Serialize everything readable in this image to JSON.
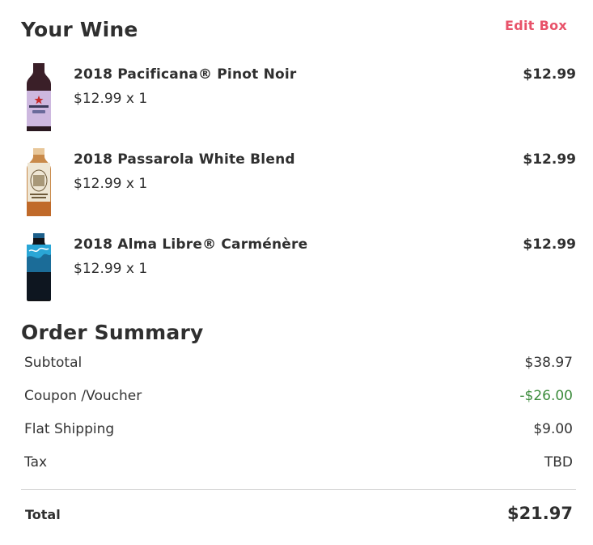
{
  "wine_section": {
    "title": "Your Wine",
    "edit_label": "Edit Box",
    "items": [
      {
        "name": "2018 Pacificana® Pinot Noir",
        "qty": "$12.99 x 1",
        "price": "$12.99"
      },
      {
        "name": "2018 Passarola White Blend",
        "qty": "$12.99 x 1",
        "price": "$12.99"
      },
      {
        "name": "2018 Alma Libre® Carménère",
        "qty": "$12.99 x 1",
        "price": "$12.99"
      }
    ]
  },
  "summary": {
    "title": "Order Summary",
    "rows": [
      {
        "label": "Subtotal",
        "value": "$38.97"
      },
      {
        "label": "Coupon /Voucher",
        "value": "-$26.00"
      },
      {
        "label": "Flat Shipping",
        "value": "$9.00"
      },
      {
        "label": "Tax",
        "value": "TBD"
      }
    ],
    "total_label": "Total",
    "total_value": "$21.97"
  },
  "colors": {
    "accent": "#e8536a",
    "discount": "#3d8c3d",
    "text": "#2f2f2f"
  }
}
